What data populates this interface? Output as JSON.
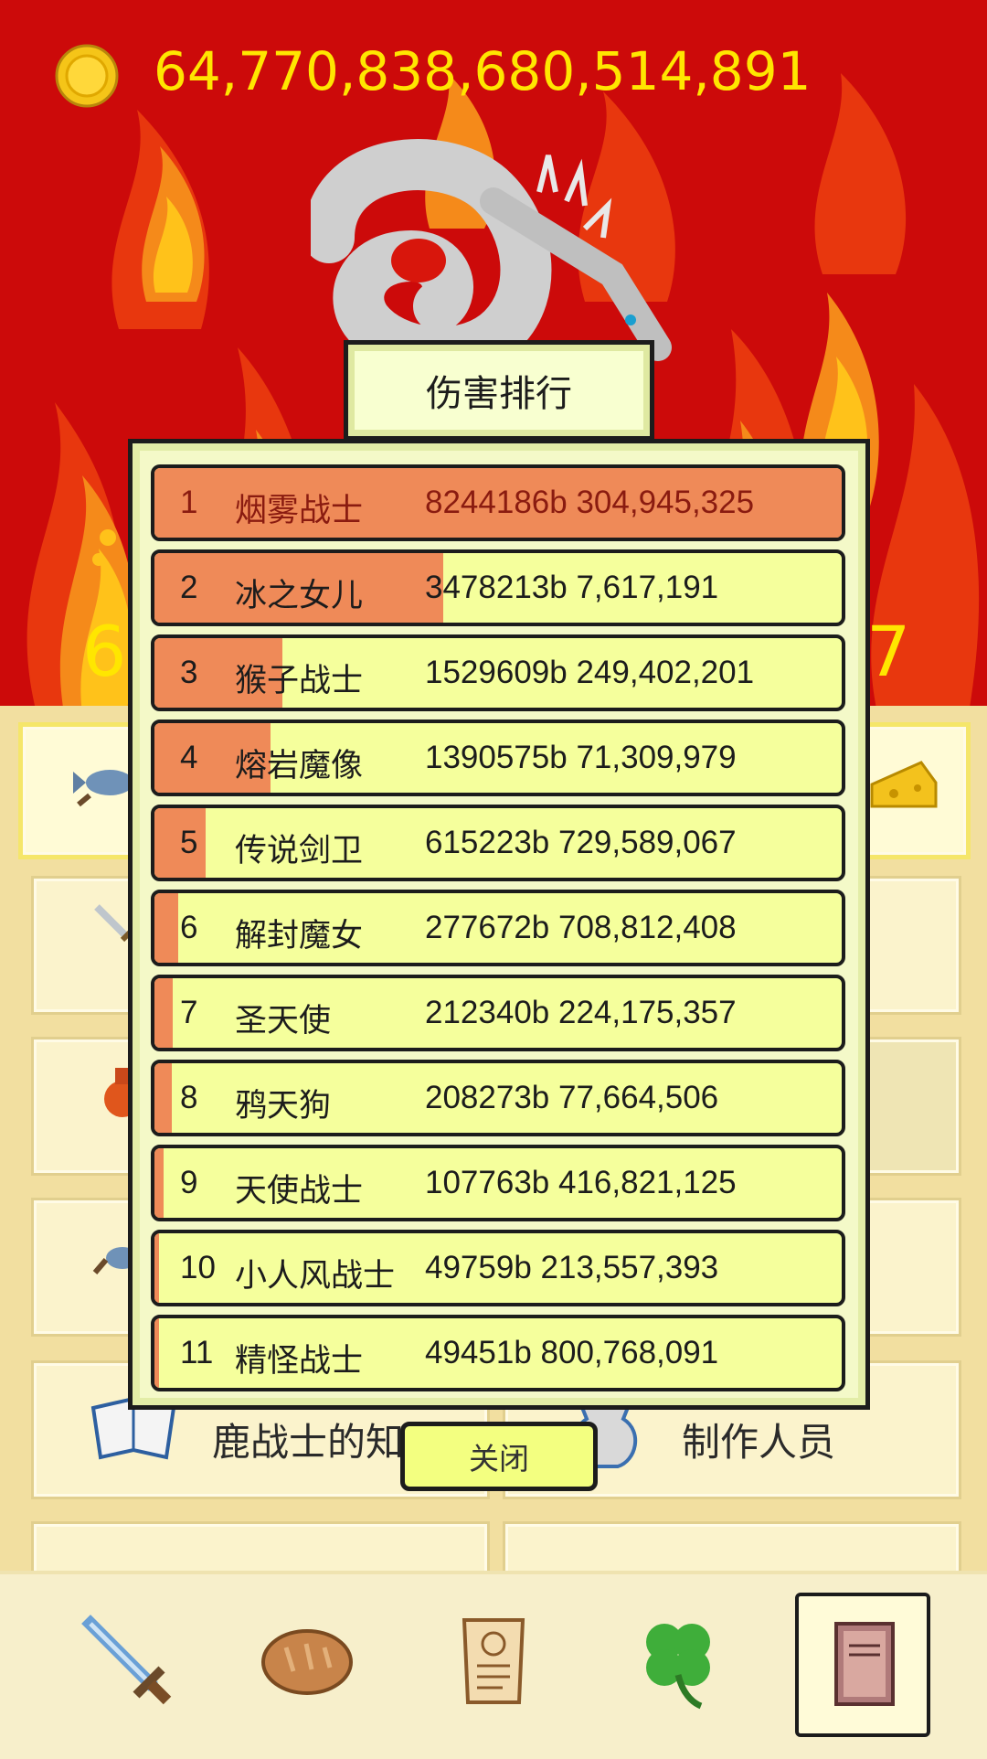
{
  "header": {
    "coins": "64,770,838,680,514,891"
  },
  "background_partial_number": {
    "left": "6",
    "right": "7"
  },
  "ranking": {
    "title": "伤害排行",
    "rows": [
      {
        "rank": "1",
        "name": "烟雾战士",
        "damage": "8244186b 304,945,325",
        "share": 1.0
      },
      {
        "rank": "2",
        "name": "冰之女儿",
        "damage": "3478213b 7,617,191",
        "share": 0.42
      },
      {
        "rank": "3",
        "name": "猴子战士",
        "damage": "1529609b 249,402,201",
        "share": 0.186
      },
      {
        "rank": "4",
        "name": "熔岩魔像",
        "damage": "1390575b 71,309,979",
        "share": 0.169
      },
      {
        "rank": "5",
        "name": "传说剑卫",
        "damage": "615223b 729,589,067",
        "share": 0.075
      },
      {
        "rank": "6",
        "name": "解封魔女",
        "damage": "277672b 708,812,408",
        "share": 0.034
      },
      {
        "rank": "7",
        "name": "圣天使",
        "damage": "212340b 224,175,357",
        "share": 0.026
      },
      {
        "rank": "8",
        "name": "鸦天狗",
        "damage": "208273b 77,664,506",
        "share": 0.025
      },
      {
        "rank": "9",
        "name": "天使战士",
        "damage": "107763b 416,821,125",
        "share": 0.013
      },
      {
        "rank": "10",
        "name": "小人风战士",
        "damage": "49759b 213,557,393",
        "share": 0.006
      },
      {
        "rank": "11",
        "name": "精怪战士",
        "damage": "49451b 800,768,091",
        "share": 0.006
      }
    ],
    "close_label": "关闭"
  },
  "menu": {
    "knowledge_label": "鹿战士的知识",
    "credits_label": "制作人员"
  },
  "tabs": [
    {
      "icon": "sword-icon"
    },
    {
      "icon": "bread-icon"
    },
    {
      "icon": "scroll-icon"
    },
    {
      "icon": "clover-icon"
    },
    {
      "icon": "book-icon",
      "active": true
    }
  ],
  "colors": {
    "fire_red": "#c40808",
    "coin_text": "#ffe600",
    "row_bg": "#f5ff9c",
    "bar_fill": "#ef8a58"
  }
}
